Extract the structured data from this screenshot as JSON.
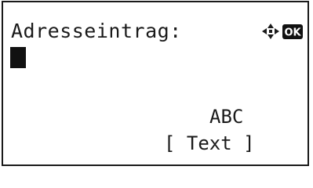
{
  "screen": {
    "title": "Adresseintrag:",
    "input_value": "",
    "nav_icon": "four-way-arrow-icon",
    "ok_badge": "OK",
    "input_mode": "ABC",
    "softkey_label": "[ Text ]"
  },
  "colors": {
    "text": "#1a1a1a",
    "background": "#ffffff",
    "badge_bg": "#111111",
    "badge_text": "#ffffff"
  }
}
